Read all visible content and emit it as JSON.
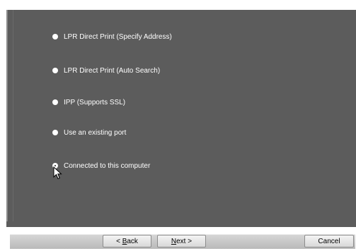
{
  "options": [
    {
      "label": "LPR Direct Print (Specify Address)",
      "selected": false
    },
    {
      "label": "LPR Direct Print (Auto Search)",
      "selected": false
    },
    {
      "label": "IPP (Supports SSL)",
      "selected": false
    },
    {
      "label": "Use an existing port",
      "selected": false
    },
    {
      "label": "Connected to this computer",
      "selected": true
    }
  ],
  "buttons": {
    "back": {
      "prefix": "< ",
      "mnemonic": "B",
      "rest": "ack"
    },
    "next": {
      "mnemonic": "N",
      "rest": "ext >"
    },
    "cancel": "Cancel"
  },
  "colors": {
    "panel": "#5c5c5c",
    "bar": "#c8c8c8"
  }
}
